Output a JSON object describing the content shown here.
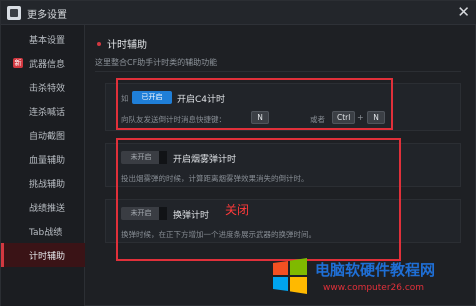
{
  "window": {
    "title": "更多设置",
    "close_glyph": "✕"
  },
  "sidebar": {
    "items": [
      {
        "label": "基本设置"
      },
      {
        "label": "武器信息",
        "badge": "新"
      },
      {
        "label": "击杀特效"
      },
      {
        "label": "连杀喊话"
      },
      {
        "label": "自动截图"
      },
      {
        "label": "血量辅助"
      },
      {
        "label": "挑战辅助"
      },
      {
        "label": "战绩推送"
      },
      {
        "label": "Tab战绩"
      },
      {
        "label": "计时辅助"
      }
    ],
    "active_index": 9
  },
  "section": {
    "title": "计时辅助",
    "description": "这里整合CF助手计时类的辅助功能"
  },
  "options": {
    "c4": {
      "toggle_text": "已开启",
      "toggle_prefix": "如",
      "label": "开启C4计时",
      "desc": "向队友发送倒计时消息快捷键：",
      "key1": "N",
      "or_text": "或者",
      "key2": "Ctrl",
      "plus": "+",
      "key3": "N"
    },
    "smoke": {
      "toggle_text": "未开启",
      "label": "开启烟雾弹计时",
      "desc": "投出烟雾弹的时候，计算距离烟雾弹效果消失的倒计时。"
    },
    "reload": {
      "toggle_text": "未开启",
      "label": "换弹计时",
      "desc": "换弹时候，在正下方增加一个进度条展示武器的换弹时间。"
    }
  },
  "annotation": "关闭",
  "watermark": {
    "title": "电脑软硬件教程网",
    "url": "www.computer26.com"
  },
  "colors": {
    "accent": "#d23840",
    "toggle_on": "#1f7fd8",
    "highlight_box": "#e0303a",
    "watermark_blue": "#1f6fd6"
  }
}
